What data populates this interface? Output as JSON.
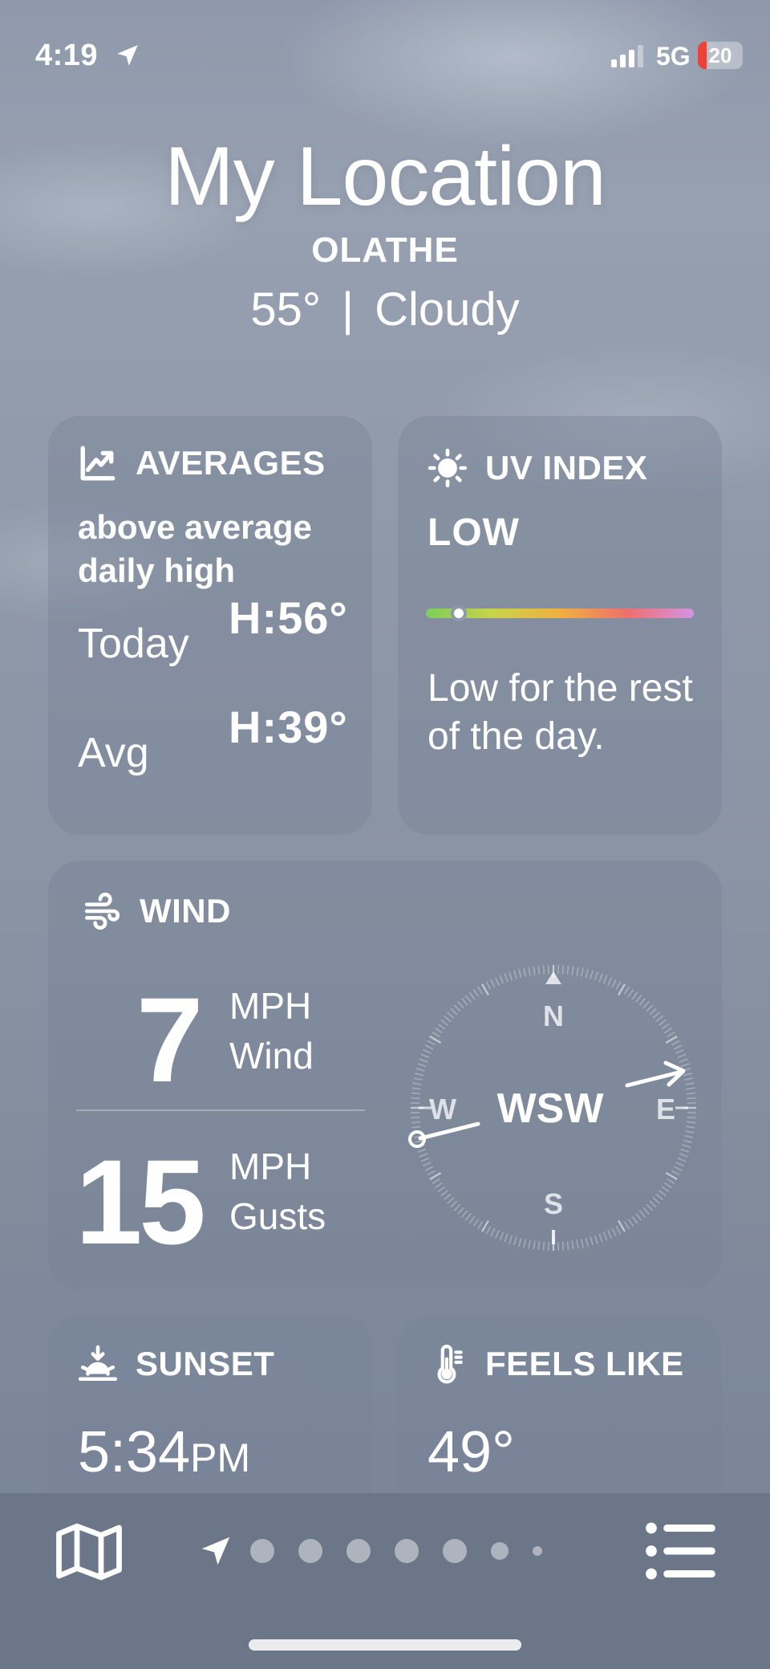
{
  "status_bar": {
    "time": "4:19",
    "network": "5G",
    "battery_level": "20",
    "battery_color": "#e8443a"
  },
  "header": {
    "title": "My Location",
    "city": "OLATHE",
    "temperature": "55°",
    "separator": "|",
    "condition": "Cloudy"
  },
  "averages": {
    "title": "AVERAGES",
    "icon": "chart-line-up-icon",
    "description": "above average daily high",
    "today_label": "Today",
    "today_value": "H:56°",
    "avg_label": "Avg",
    "avg_value": "H:39°"
  },
  "uv_index": {
    "title": "UV INDEX",
    "icon": "sun-icon",
    "level": "LOW",
    "level_fraction": 0.1,
    "description": "Low for the rest of the day."
  },
  "wind": {
    "title": "WIND",
    "icon": "wind-icon",
    "speed": "7",
    "speed_unit": "MPH",
    "speed_label": "Wind",
    "gusts": "15",
    "gusts_unit": "MPH",
    "gusts_label": "Gusts",
    "direction": "WSW",
    "compass": {
      "n": "N",
      "s": "S",
      "e": "E",
      "w": "W"
    }
  },
  "sunset": {
    "title": "SUNSET",
    "icon": "sunset-icon",
    "time": "5:34",
    "suffix": "PM"
  },
  "feels_like": {
    "title": "FEELS LIKE",
    "icon": "thermometer-icon",
    "value": "49°"
  },
  "bottom_bar": {
    "map_icon": "map-icon",
    "location_icon": "location-arrow-icon",
    "page_count": 7,
    "list_icon": "list-icon"
  }
}
